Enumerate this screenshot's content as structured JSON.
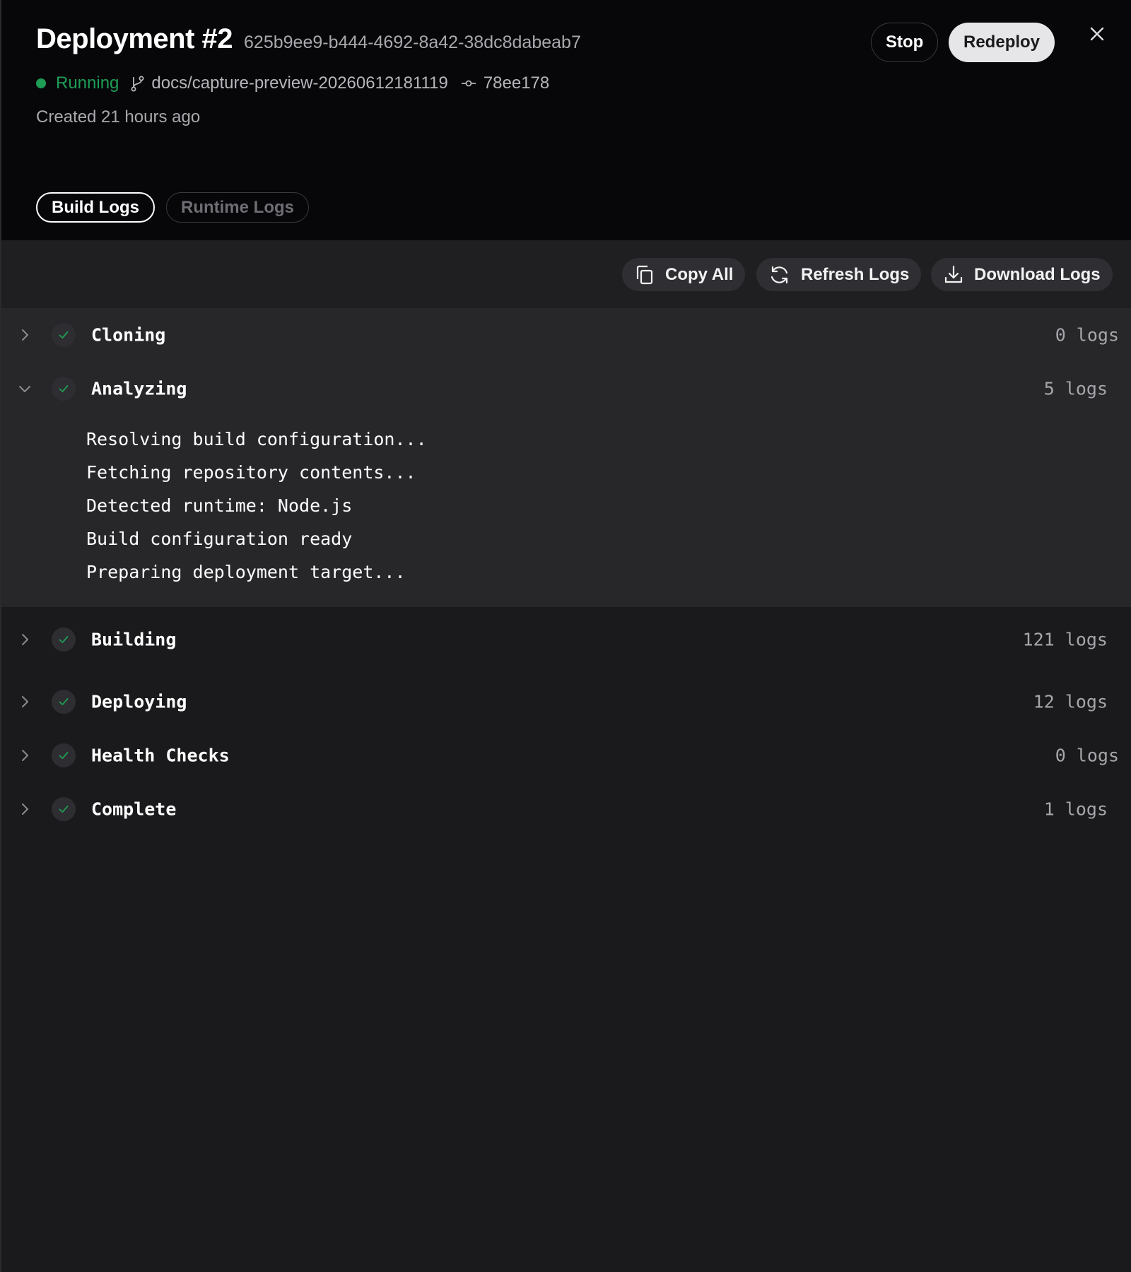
{
  "header": {
    "title": "Deployment #2",
    "deployment_id": "625b9ee9-b444-4692-8a42-38dc8dabeab7",
    "status": "Running",
    "status_color": "#1f9d55",
    "branch": "docs/capture-preview-20260612181119",
    "commit": "78ee178",
    "created": "Created 21 hours ago",
    "stop_label": "Stop",
    "redeploy_label": "Redeploy"
  },
  "tabs": [
    {
      "label": "Build Logs",
      "active": true
    },
    {
      "label": "Runtime Logs",
      "active": false
    }
  ],
  "toolbar": {
    "copy_label": "Copy All",
    "refresh_label": "Refresh Logs",
    "download_label": "Download Logs"
  },
  "stages": [
    {
      "name": "Cloning",
      "count": "0 logs",
      "expanded": false
    },
    {
      "name": "Analyzing",
      "count": "5 logs",
      "expanded": true,
      "logs": [
        "Resolving build configuration...",
        "Fetching repository contents...",
        "Detected runtime: Node.js",
        "Build configuration ready",
        "Preparing deployment target..."
      ]
    },
    {
      "name": "Building",
      "count": "121 logs",
      "expanded": false
    },
    {
      "name": "Deploying",
      "count": "12 logs",
      "expanded": false
    },
    {
      "name": "Health Checks",
      "count": "0 logs",
      "expanded": false
    },
    {
      "name": "Complete",
      "count": "1 logs",
      "expanded": false
    }
  ]
}
